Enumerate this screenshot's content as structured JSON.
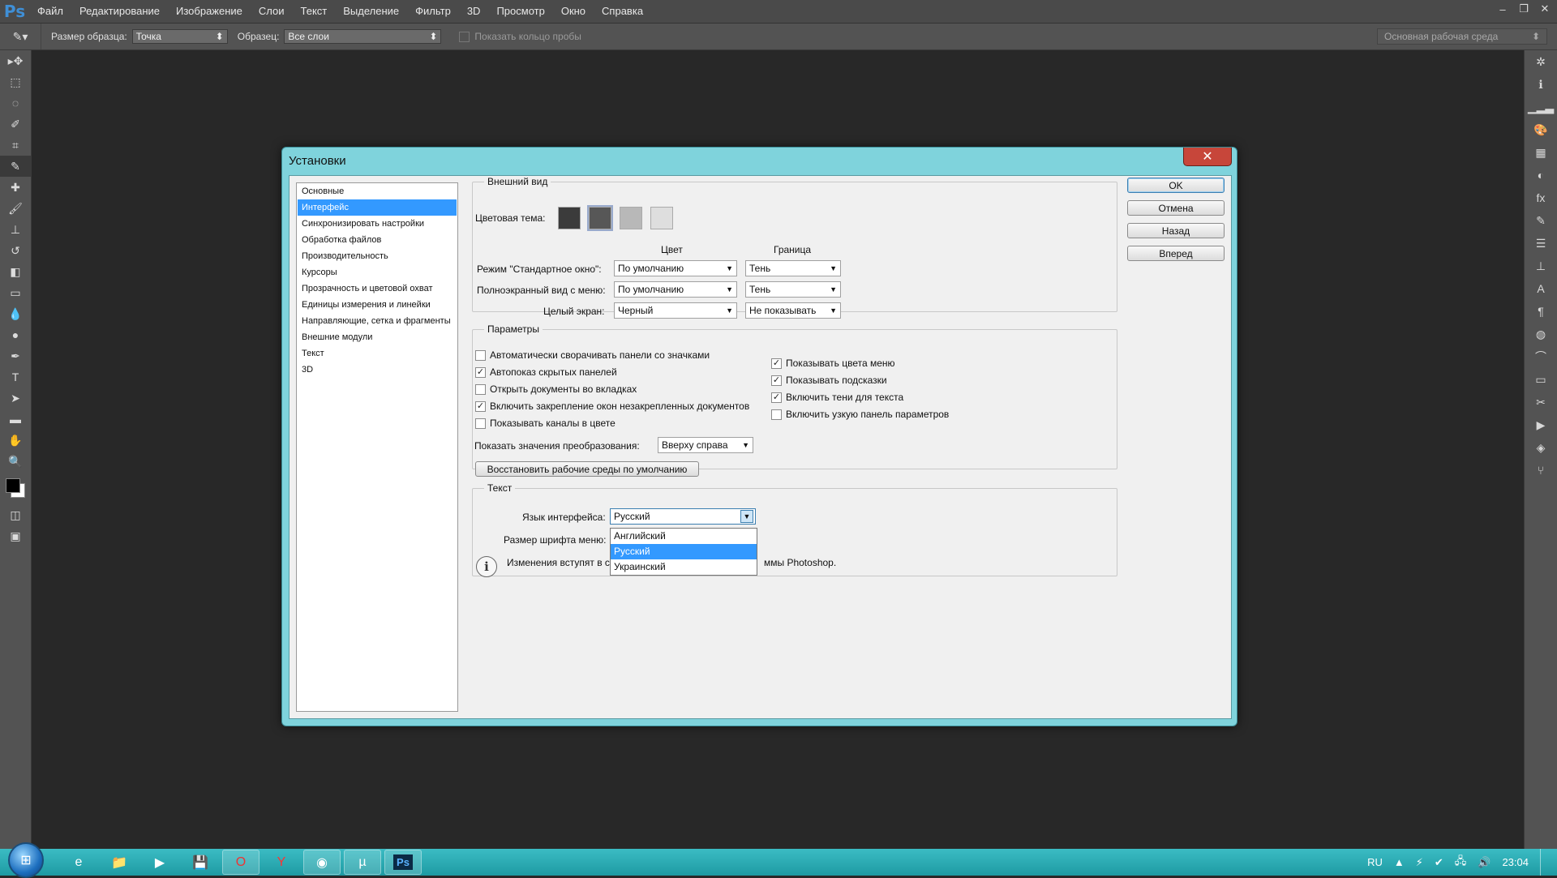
{
  "app": {
    "menu": [
      "Файл",
      "Редактирование",
      "Изображение",
      "Слои",
      "Текст",
      "Выделение",
      "Фильтр",
      "3D",
      "Просмотр",
      "Окно",
      "Справка"
    ],
    "options_bar": {
      "sample_size_label": "Размер образца:",
      "sample_size_value": "Точка",
      "sample_label": "Образец:",
      "sample_value": "Все слои",
      "show_ring_label": "Показать кольцо пробы",
      "workspace": "Основная рабочая среда"
    }
  },
  "dialog": {
    "title": "Установки",
    "nav": [
      "Основные",
      "Интерфейс",
      "Синхронизировать настройки",
      "Обработка файлов",
      "Производительность",
      "Курсоры",
      "Прозрачность и цветовой охват",
      "Единицы измерения и линейки",
      "Направляющие, сетка и фрагменты",
      "Внешние модули",
      "Текст",
      "3D"
    ],
    "nav_selected": 1,
    "buttons": {
      "ok": "OK",
      "cancel": "Отмена",
      "back": "Назад",
      "forward": "Вперед"
    },
    "appearance": {
      "legend": "Внешний вид",
      "color_theme_label": "Цветовая тема:",
      "themes": [
        "#3b3b3b",
        "#575757",
        "#b8b8b8",
        "#dedede"
      ],
      "col_color": "Цвет",
      "col_border": "Граница",
      "rows": [
        {
          "label": "Режим \"Стандартное окно\":",
          "color": "По умолчанию",
          "border": "Тень"
        },
        {
          "label": "Полноэкранный вид с меню:",
          "color": "По умолчанию",
          "border": "Тень"
        },
        {
          "label": "Целый экран:",
          "color": "Черный",
          "border": "Не показывать"
        }
      ]
    },
    "params": {
      "legend": "Параметры",
      "left": [
        {
          "label": "Автоматически сворачивать панели со значками",
          "checked": false
        },
        {
          "label": "Автопоказ скрытых панелей",
          "checked": true
        },
        {
          "label": "Открыть документы во вкладках",
          "checked": false
        },
        {
          "label": "Включить закрепление окон незакрепленных документов",
          "checked": true
        },
        {
          "label": "Показывать каналы в цвете",
          "checked": false
        }
      ],
      "right": [
        {
          "label": "Показывать цвета меню",
          "checked": true
        },
        {
          "label": "Показывать подсказки",
          "checked": true
        },
        {
          "label": "Включить тени для текста",
          "checked": true
        },
        {
          "label": "Включить узкую панель параметров",
          "checked": false
        }
      ],
      "transform_label": "Показать значения преобразования:",
      "transform_value": "Вверху справа",
      "restore_button": "Восстановить рабочие среды по умолчанию"
    },
    "text": {
      "legend": "Текст",
      "lang_label": "Язык интерфейса:",
      "lang_value": "Русский",
      "lang_options": [
        "Английский",
        "Русский",
        "Украинский"
      ],
      "lang_highlight": 1,
      "font_size_label": "Размер шрифта меню:",
      "note_start": "Изменения вступят в с",
      "note_end": "ммы Photoshop."
    }
  },
  "taskbar": {
    "lang": "RU",
    "time": "23:04"
  }
}
